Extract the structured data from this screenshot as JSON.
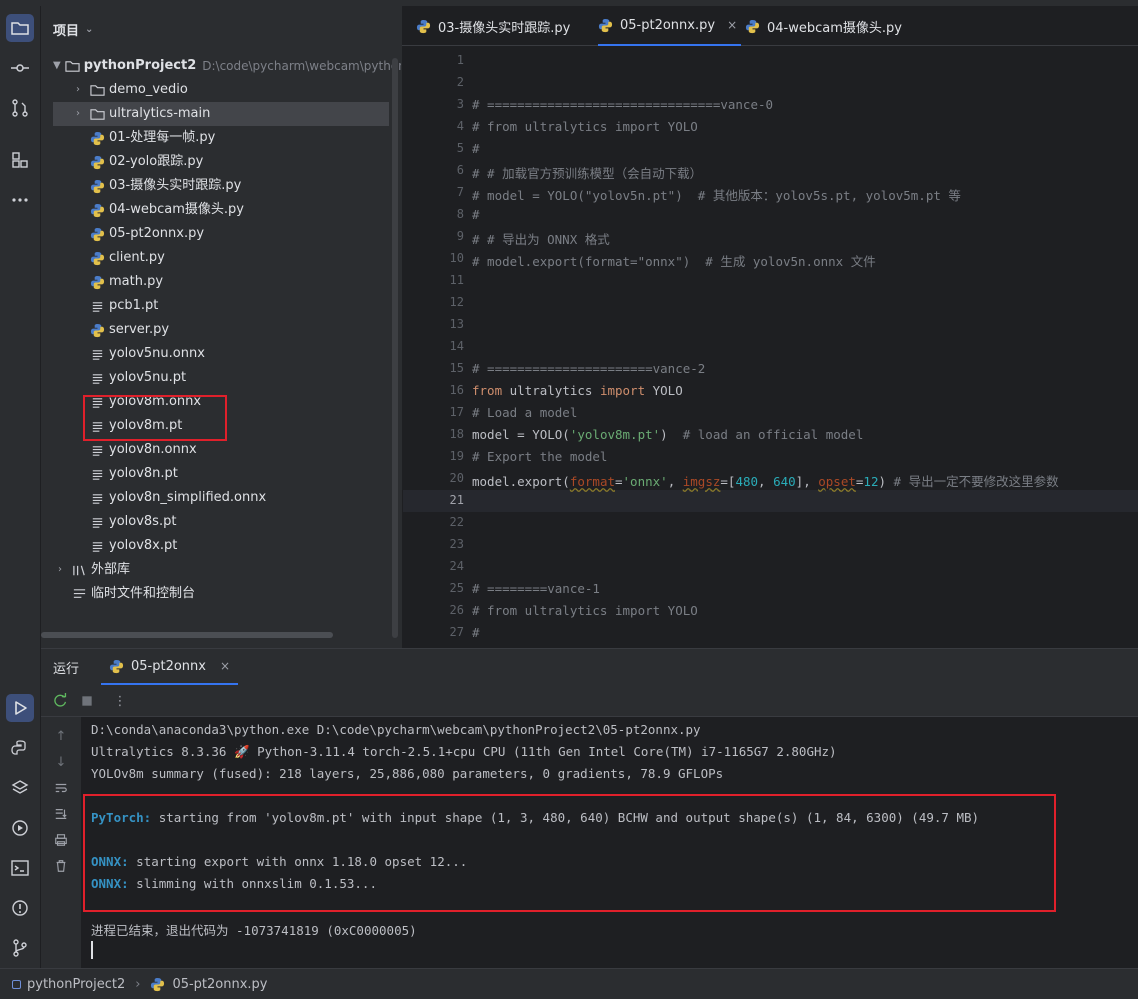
{
  "project_panel": {
    "title": "项目",
    "root": {
      "name": "pythonProject2",
      "path": "D:\\code\\pycharm\\webcam\\pythonPr"
    },
    "items": [
      {
        "label": "demo_vedio",
        "type": "folder"
      },
      {
        "label": "ultralytics-main",
        "type": "folder"
      },
      {
        "label": "01-处理每一帧.py",
        "type": "python"
      },
      {
        "label": "02-yolo跟踪.py",
        "type": "python"
      },
      {
        "label": "03-摄像头实时跟踪.py",
        "type": "python"
      },
      {
        "label": "04-webcam摄像头.py",
        "type": "python"
      },
      {
        "label": "05-pt2onnx.py",
        "type": "python"
      },
      {
        "label": "client.py",
        "type": "python"
      },
      {
        "label": "math.py",
        "type": "python"
      },
      {
        "label": "pcb1.pt",
        "type": "file"
      },
      {
        "label": "server.py",
        "type": "python"
      },
      {
        "label": "yolov5nu.onnx",
        "type": "file"
      },
      {
        "label": "yolov5nu.pt",
        "type": "file"
      },
      {
        "label": "yolov8m.onnx",
        "type": "file"
      },
      {
        "label": "yolov8m.pt",
        "type": "file"
      },
      {
        "label": "yolov8n.onnx",
        "type": "file"
      },
      {
        "label": "yolov8n.pt",
        "type": "file"
      },
      {
        "label": "yolov8n_simplified.onnx",
        "type": "file"
      },
      {
        "label": "yolov8s.pt",
        "type": "file"
      },
      {
        "label": "yolov8x.pt",
        "type": "file"
      }
    ],
    "external_libs": "外部库",
    "scratches": "临时文件和控制台"
  },
  "editor": {
    "tabs": [
      {
        "label": "03-摄像头实时跟踪.py"
      },
      {
        "label": "05-pt2onnx.py"
      },
      {
        "label": "04-webcam摄像头.py"
      }
    ],
    "close_glyph": "×",
    "line_numbers": [
      "1",
      "2",
      "3",
      "4",
      "5",
      "6",
      "7",
      "8",
      "9",
      "10",
      "11",
      "12",
      "13",
      "14",
      "15",
      "16",
      "17",
      "18",
      "19",
      "20",
      "21",
      "22",
      "23",
      "24",
      "25",
      "26",
      "27"
    ],
    "code": {
      "l3": "# ===============================vance-0",
      "l4": "# from ultralytics import YOLO",
      "l5": "#",
      "l6": "# # 加载官方预训练模型（会自动下载）",
      "l7": "# model = YOLO(\"yolov5n.pt\")  # 其他版本：yolov5s.pt, yolov5m.pt 等",
      "l8": "#",
      "l9": "# # 导出为 ONNX 格式",
      "l10": "# model.export(format=\"onnx\")  # 生成 yolov5n.onnx 文件",
      "l15": "# ======================vance-2",
      "l16_kw1": "from",
      "l16_mid": " ultralytics ",
      "l16_kw2": "import",
      "l16_end": " YOLO",
      "l17": "# Load a model",
      "l18_a": "model = YOLO(",
      "l18_str": "'yolov8m.pt'",
      "l18_b": ")  ",
      "l18_cmt": "# load an official model",
      "l19": "# Export the model",
      "l20_a": "model.export(",
      "l20_p1": "format",
      "l20_eq1": "=",
      "l20_s1": "'onnx'",
      "l20_c1": ", ",
      "l20_p2": "imgsz",
      "l20_eq2": "=[",
      "l20_n1": "480",
      "l20_c2": ", ",
      "l20_n2": "640",
      "l20_c3": "], ",
      "l20_p3": "opset",
      "l20_eq3": "=",
      "l20_n3": "12",
      "l20_b": ") ",
      "l20_cmt": "# 导出一定不要修改这里参数",
      "l25": "# ========vance-1",
      "l26": "# from ultralytics import YOLO",
      "l27": "#"
    }
  },
  "run_panel": {
    "label": "运行",
    "tab": "05-pt2onnx",
    "close_glyph": "×",
    "more_glyph": "⋮",
    "lines": {
      "cmd": "D:\\conda\\anaconda3\\python.exe D:\\code\\pycharm\\webcam\\pythonProject2\\05-pt2onnx.py",
      "ultra": "Ultralytics 8.3.36 🚀 Python-3.11.4 torch-2.5.1+cpu CPU (11th Gen Intel Core(TM) i7-1165G7 2.80GHz)",
      "summary": "YOLOv8m summary (fused): 218 layers, 25,886,080 parameters, 0 gradients, 78.9 GFLOPs",
      "pt_prefix": "PyTorch:",
      "pt_text": " starting from 'yolov8m.pt' with input shape (1, 3, 480, 640) BCHW and output shape(s) (1, 84, 6300) (49.7 MB)",
      "onnx1_prefix": "ONNX:",
      "onnx1_text": " starting export with onnx 1.18.0 opset 12...",
      "onnx2_prefix": "ONNX:",
      "onnx2_text": " slimming with onnxslim 0.1.53...",
      "exit": "进程已结束，退出代码为 -1073741819 (0xC0000005)"
    }
  },
  "status_bar": {
    "project": "pythonProject2",
    "separator": "›",
    "file": "05-pt2onnx.py"
  },
  "colors": {
    "accent": "#3574f0",
    "highlight_box": "#e0202b",
    "console_prefix": "#3592c4"
  }
}
